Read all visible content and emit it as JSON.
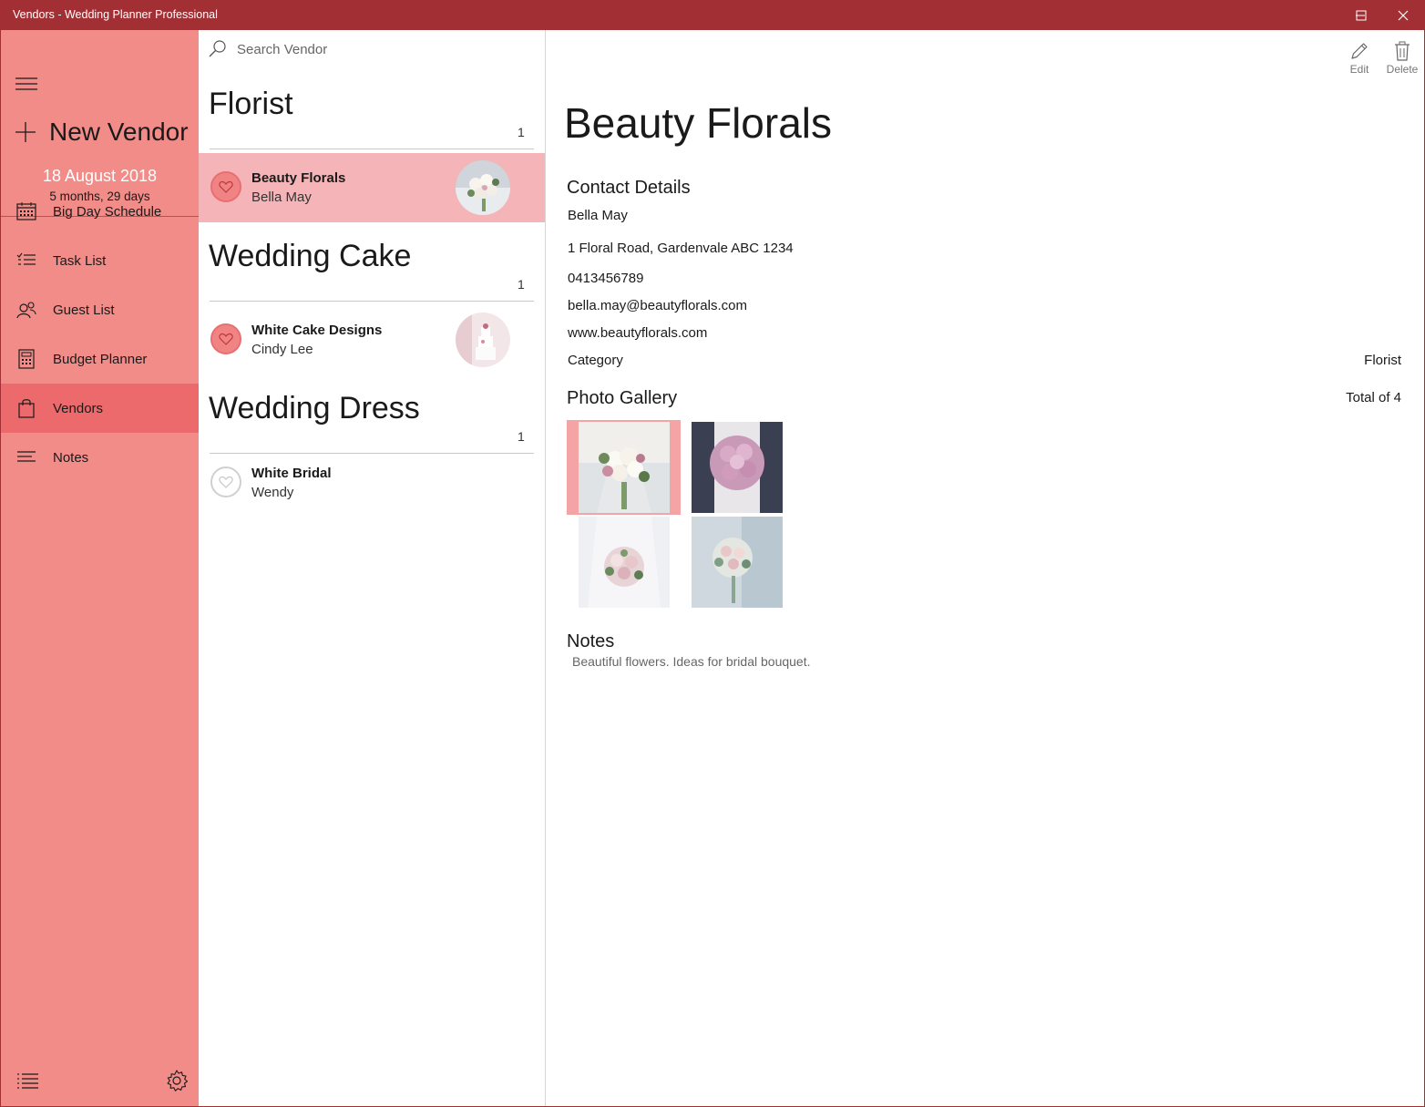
{
  "window": {
    "title": "Vendors - Wedding Planner Professional",
    "accent": "#a22f34"
  },
  "sidebar": {
    "new_vendor_label": "New Vendor",
    "event_date": "18 August 2018",
    "countdown": "5 months, 29 days",
    "items": [
      {
        "label": "Big Day Schedule",
        "icon": "calendar-icon"
      },
      {
        "label": "Task List",
        "icon": "task-list-icon"
      },
      {
        "label": "Guest List",
        "icon": "guests-icon"
      },
      {
        "label": "Budget Planner",
        "icon": "calculator-icon"
      },
      {
        "label": "Vendors",
        "icon": "shopping-bag-icon",
        "active": true
      },
      {
        "label": "Notes",
        "icon": "notes-icon"
      }
    ],
    "color": "#f28c88",
    "active_color": "#ec6a6b"
  },
  "list": {
    "search_placeholder": "Search Vendor",
    "groups": [
      {
        "title": "Florist",
        "count": "1",
        "vendors": [
          {
            "name": "Beauty Florals",
            "contact": "Bella May",
            "favorite": true,
            "selected": true
          }
        ]
      },
      {
        "title": "Wedding Cake",
        "count": "1",
        "vendors": [
          {
            "name": "White Cake Designs",
            "contact": "Cindy Lee",
            "favorite": true
          }
        ]
      },
      {
        "title": "Wedding Dress",
        "count": "1",
        "vendors": [
          {
            "name": "White Bridal",
            "contact": "Wendy",
            "favorite": false
          }
        ]
      }
    ]
  },
  "detail": {
    "toolbar": {
      "edit_label": "Edit",
      "delete_label": "Delete"
    },
    "title": "Beauty Florals",
    "contact_heading": "Contact Details",
    "contact_name": "Bella May",
    "address": "1 Floral Road, Gardenvale ABC 1234",
    "phone": "0413456789",
    "email": "bella.may@beautyflorals.com",
    "website": "www.beautyflorals.com",
    "category_label": "Category",
    "category_value": "Florist",
    "gallery_heading": "Photo Gallery",
    "gallery_total": "Total of 4",
    "notes_heading": "Notes",
    "notes_text": "Beautiful flowers. Ideas for bridal bouquet."
  }
}
